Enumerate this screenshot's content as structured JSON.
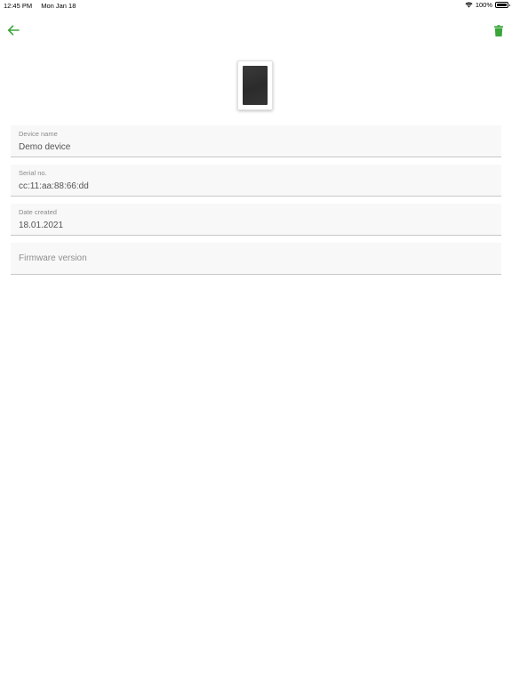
{
  "status_bar": {
    "time": "12:45 PM",
    "date": "Mon Jan 18",
    "battery": "100%"
  },
  "colors": {
    "accent": "#3aa53a"
  },
  "icons": {
    "back": "arrow-left-icon",
    "delete": "trash-icon",
    "device": "tablet-device-icon"
  },
  "fields": {
    "device_name": {
      "label": "Device name",
      "value": "Demo device"
    },
    "serial_no": {
      "label": "Serial no.",
      "value": "cc:11:aa:88:66:dd"
    },
    "date_created": {
      "label": "Date created",
      "value": "18.01.2021"
    },
    "firmware_version": {
      "placeholder": "Firmware version"
    }
  }
}
